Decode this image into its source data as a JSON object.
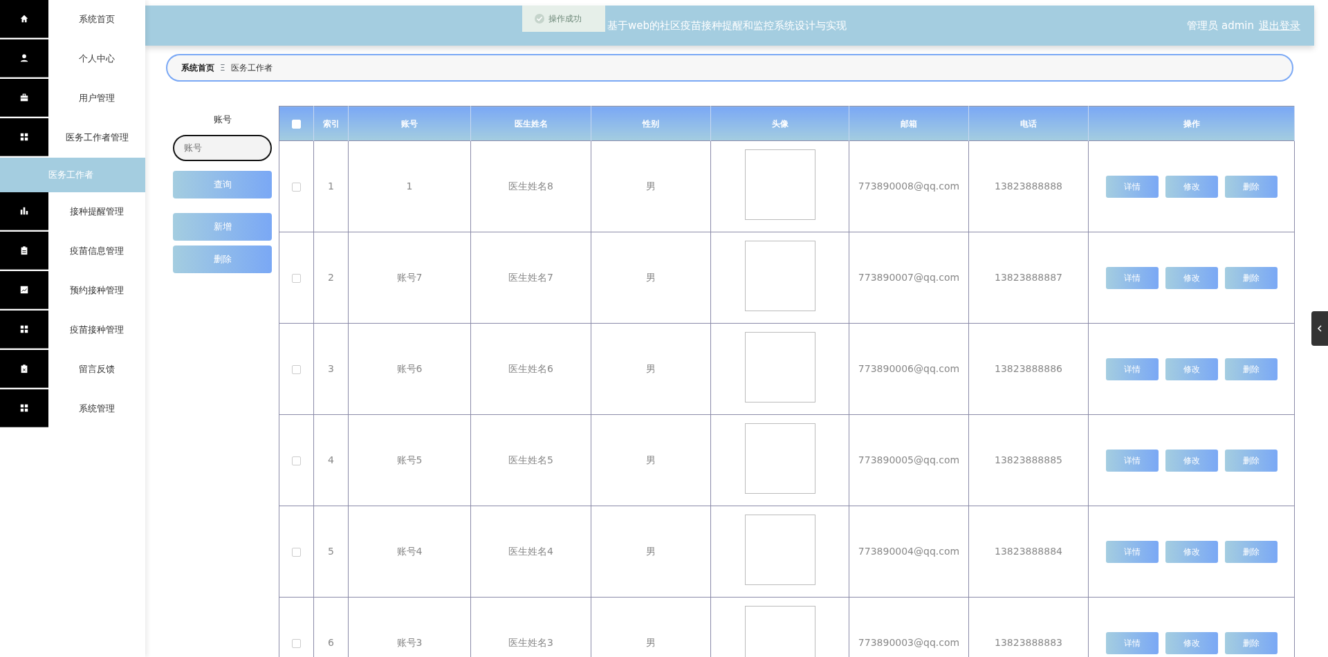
{
  "toast": {
    "text": "操作成功"
  },
  "header": {
    "title": "基于web的社区疫苗接种提醒和监控系统设计与实现",
    "user": "管理员 admin",
    "logout": "退出登录"
  },
  "sidebar": {
    "items": [
      {
        "label": "系统首页",
        "selected": false
      },
      {
        "label": "个人中心",
        "selected": false
      },
      {
        "label": "用户管理",
        "selected": false
      },
      {
        "label": "医务工作者管理",
        "selected": false,
        "children": [
          {
            "label": "医务工作者",
            "selected": true
          }
        ]
      },
      {
        "label": "接种提醒管理",
        "selected": false
      },
      {
        "label": "疫苗信息管理",
        "selected": false
      },
      {
        "label": "预约接种管理",
        "selected": false
      },
      {
        "label": "疫苗接种管理",
        "selected": false
      },
      {
        "label": "留言反馈",
        "selected": false
      },
      {
        "label": "系统管理",
        "selected": false
      }
    ]
  },
  "breadcrumb": [
    "系统首页",
    "医务工作者"
  ],
  "breadcrumb_separator": "Ξ",
  "search": {
    "label": "账号",
    "placeholder": "账号",
    "buttons": [
      "查询",
      "新增",
      "删除"
    ]
  },
  "table": {
    "select_all": false,
    "columns": [
      {
        "label": "索引"
      },
      {
        "label": "账号"
      },
      {
        "label": "医生姓名"
      },
      {
        "label": "性别"
      },
      {
        "label": "头像",
        "kind": "image"
      },
      {
        "label": "邮箱"
      },
      {
        "label": "电话"
      },
      {
        "label": "操作"
      }
    ],
    "rows": [
      {
        "selected": false,
        "cells": [
          "1",
          "1",
          "医生姓名8",
          "男",
          "",
          "773890008@qq.com",
          "13823888888"
        ],
        "actions": [
          "详情",
          "修改",
          "删除"
        ]
      },
      {
        "selected": false,
        "cells": [
          "2",
          "账号7",
          "医生姓名7",
          "男",
          "",
          "773890007@qq.com",
          "13823888887"
        ],
        "actions": [
          "详情",
          "修改",
          "删除"
        ]
      },
      {
        "selected": false,
        "cells": [
          "3",
          "账号6",
          "医生姓名6",
          "男",
          "",
          "773890006@qq.com",
          "13823888886"
        ],
        "actions": [
          "详情",
          "修改",
          "删除"
        ]
      },
      {
        "selected": false,
        "cells": [
          "4",
          "账号5",
          "医生姓名5",
          "男",
          "",
          "773890005@qq.com",
          "13823888885"
        ],
        "actions": [
          "详情",
          "修改",
          "删除"
        ]
      },
      {
        "selected": false,
        "cells": [
          "5",
          "账号4",
          "医生姓名4",
          "男",
          "",
          "773890004@qq.com",
          "13823888884"
        ],
        "actions": [
          "详情",
          "修改",
          "删除"
        ]
      },
      {
        "selected": false,
        "cells": [
          "6",
          "账号3",
          "医生姓名3",
          "男",
          "",
          "773890003@qq.com",
          "13823888883"
        ],
        "actions": [
          "详情",
          "修改",
          "删除"
        ]
      }
    ]
  }
}
